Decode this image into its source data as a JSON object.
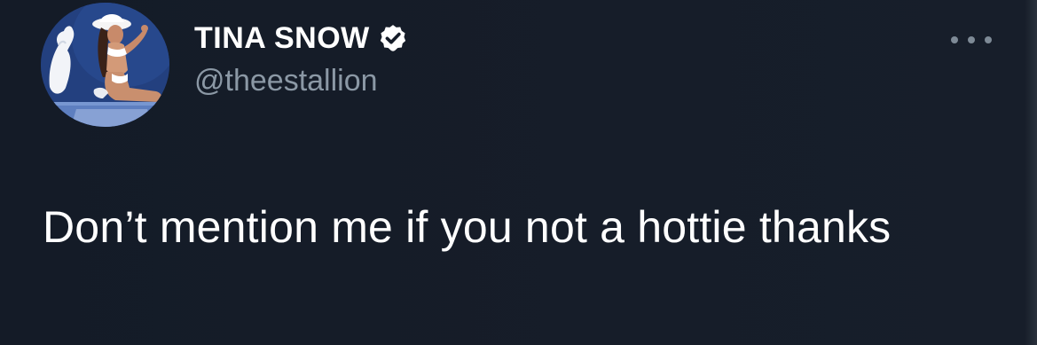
{
  "tweet": {
    "display_name": "TINA SNOW",
    "handle": "@theestallion",
    "verified": true,
    "text": "Don’t mention me if you not a hottie thanks"
  },
  "icons": {
    "verified": "verified-badge-icon",
    "more": "more-options-icon"
  },
  "colors": {
    "background": "#151c28",
    "name": "#ffffff",
    "handle": "#8b98a5",
    "text": "#ffffff"
  }
}
